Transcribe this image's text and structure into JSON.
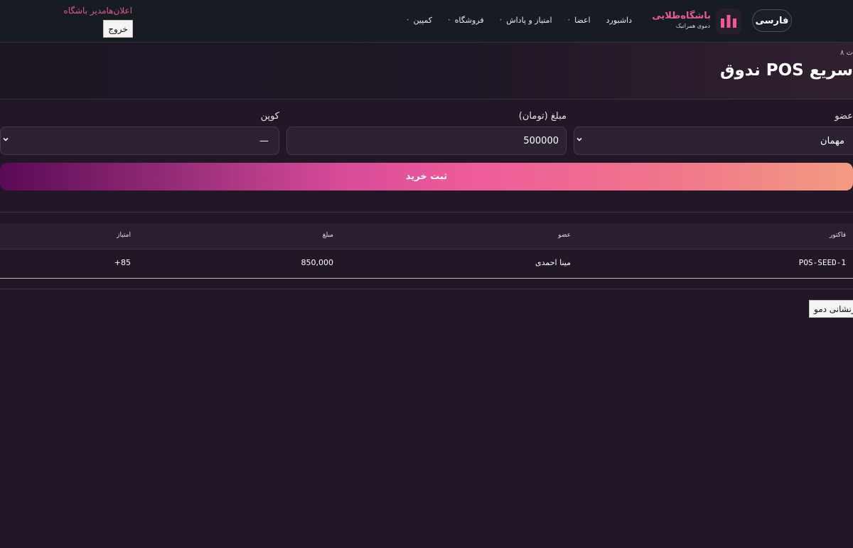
{
  "topbar": {
    "lang_label": "فارسی",
    "brand_name": "باشگاه‌طلایی",
    "brand_sub": "دموی همرانیک",
    "logo_icon": "bar-chart-logo-icon",
    "nav": [
      {
        "label": "داشبورد",
        "caret": ""
      },
      {
        "label": "اعضا",
        "caret": "•"
      },
      {
        "label": "امتیاز و پاداش",
        "caret": "•"
      },
      {
        "label": "فروشگاه",
        "caret": "•"
      },
      {
        "label": "کمپین",
        "caret": "•"
      }
    ],
    "announcements": "اعلان‌هامدیر باشگاه",
    "logout_label": "خروج"
  },
  "hero": {
    "kicker": "ت ۸",
    "title": "ندوق POS سریع"
  },
  "form": {
    "member_label": "عضو",
    "member_value": "مهمان",
    "amount_label": "مبلغ (تومان)",
    "amount_value": "500000",
    "coupon_label": "کوپن",
    "coupon_value": "—",
    "submit_label": "ثبت خرید"
  },
  "table": {
    "headers": {
      "invoice": "فاکتور",
      "member": "عضو",
      "amount": "مبلغ",
      "points": "امتیاز"
    },
    "rows": [
      {
        "invoice": "POS-SEED-1",
        "member": "مینا احمدی",
        "amount": "850,000",
        "points": "+85"
      }
    ]
  },
  "reset_label": "بازنشانی دمو",
  "colors": {
    "brand": "#ec5a9a",
    "background": "#211727",
    "topbar": "#161c22"
  }
}
